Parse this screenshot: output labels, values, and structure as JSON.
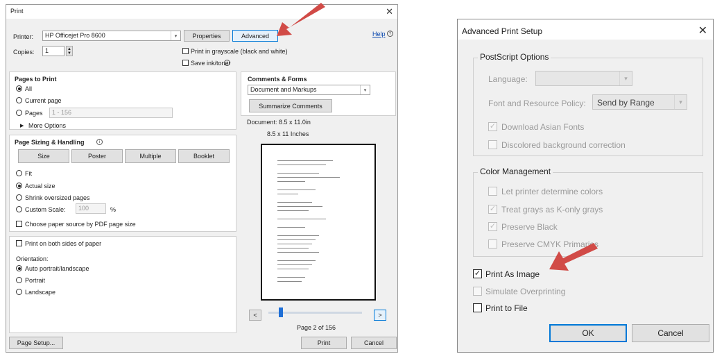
{
  "print": {
    "title": "Print",
    "printer_label": "Printer:",
    "printer_value": "HP Officejet Pro 8600",
    "properties_label": "Properties",
    "advanced_label": "Advanced",
    "help_label": "Help",
    "copies_label": "Copies:",
    "copies_value": "1",
    "grayscale_label": "Print in grayscale (black and white)",
    "save_ink_label": "Save ink/toner",
    "pages_to_print": {
      "heading": "Pages to Print",
      "all": "All",
      "current": "Current page",
      "pages": "Pages",
      "pages_value": "1 - 156",
      "more": "More Options"
    },
    "sizing": {
      "heading": "Page Sizing & Handling",
      "tabs": [
        "Size",
        "Poster",
        "Multiple",
        "Booklet"
      ],
      "fit": "Fit",
      "actual": "Actual size",
      "shrink": "Shrink oversized pages",
      "custom": "Custom Scale:",
      "custom_value": "100",
      "percent": "%",
      "choose_paper": "Choose paper source by PDF page size"
    },
    "both_sides": "Print on both sides of paper",
    "orientation": {
      "heading": "Orientation:",
      "auto": "Auto portrait/landscape",
      "portrait": "Portrait",
      "landscape": "Landscape"
    },
    "comments": {
      "heading": "Comments & Forms",
      "value": "Document and Markups",
      "summarize": "Summarize Comments"
    },
    "document_size": "Document: 8.5 x 11.0in",
    "preview_size": "8.5 x 11 Inches",
    "page_label": "Page 2 of 156",
    "page_setup": "Page Setup...",
    "print_btn": "Print",
    "cancel_btn": "Cancel"
  },
  "advanced": {
    "title": "Advanced Print Setup",
    "postscript": {
      "heading": "PostScript Options",
      "language": "Language:",
      "font_policy": "Font and Resource Policy:",
      "font_policy_value": "Send by Range",
      "download_asian": "Download Asian Fonts",
      "discolored": "Discolored background correction"
    },
    "color": {
      "heading": "Color Management",
      "let_printer": "Let printer determine colors",
      "treat_grays": "Treat grays as K-only grays",
      "preserve_black": "Preserve Black",
      "preserve_cmyk": "Preserve CMYK Primaries"
    },
    "print_as_image": "Print As Image",
    "simulate": "Simulate Overprinting",
    "print_to_file": "Print to File",
    "ok": "OK",
    "cancel": "Cancel"
  },
  "colors": {
    "arrow": "#d14b47",
    "accent_blue": "#0078d7"
  }
}
